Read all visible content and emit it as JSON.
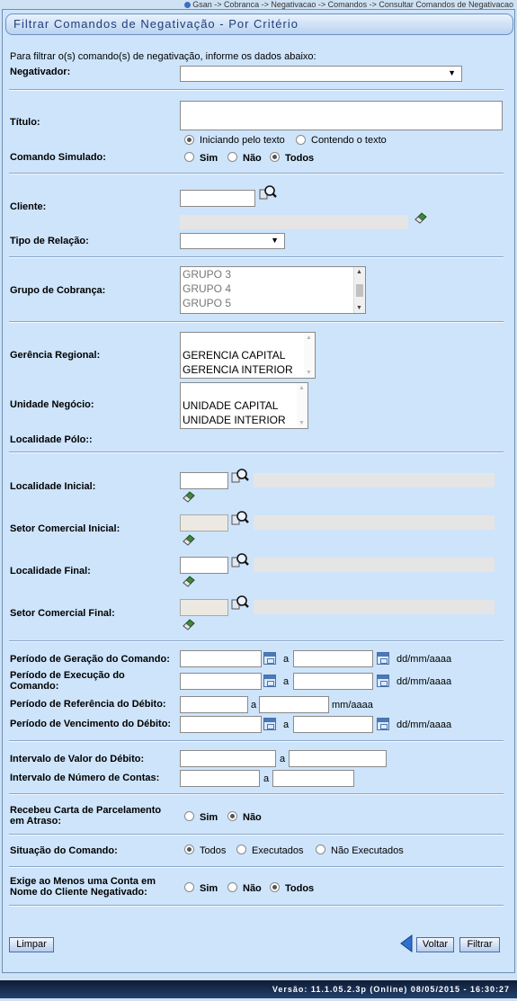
{
  "breadcrumb": "Gsan -> Cobranca -> Negativacao -> Comandos -> Consultar Comandos de Negativacao",
  "title": "Filtrar Comandos de Negativação - Por Critério",
  "intro": "Para filtrar o(s) comando(s) de negativação, informe os dados abaixo:",
  "labels": {
    "negativador": "Negativador:",
    "titulo": "Título:",
    "comando_simulado": "Comando Simulado:",
    "cliente": "Cliente:",
    "tipo_relacao": "Tipo de Relação:",
    "grupo_cobranca": "Grupo de Cobrança:",
    "gerencia_regional": "Gerência Regional:",
    "unidade_negocio": "Unidade Negócio:",
    "localidade_polo": "Localidade Pólo::",
    "localidade_inicial": "Localidade Inicial:",
    "setor_inicial": "Setor Comercial Inicial:",
    "localidade_final": "Localidade Final:",
    "setor_final": "Setor Comercial Final:",
    "periodo_geracao": "Período de Geração do Comando:",
    "periodo_execucao": "Período de Execução do Comando:",
    "periodo_referencia": "Período de Referência do Débito:",
    "periodo_vencimento": "Período de Vencimento do Débito:",
    "intervalo_valor": "Intervalo de Valor do Débito:",
    "intervalo_contas": "Intervalo de Número de Contas:",
    "recebeu_carta": "Recebeu Carta de Parcelamento em Atraso:",
    "situacao": "Situação do Comando:",
    "exige_conta": "Exige ao Menos uma Conta em Nome do Cliente Negativado:"
  },
  "titulo_options": {
    "iniciando": "Iniciando pelo texto",
    "contendo": "Contendo o texto"
  },
  "opt": {
    "sim": "Sim",
    "nao": "Não",
    "todos": "Todos",
    "executados": "Executados",
    "nao_executados": "Não Executados"
  },
  "sep_a": "a",
  "fmt_date": "dd/mm/aaaa",
  "fmt_month": "mm/aaaa",
  "grupos": [
    "GRUPO 3",
    "GRUPO 4",
    "GRUPO 5"
  ],
  "gerencias": [
    "GERENCIA CAPITAL",
    "GERENCIA INTERIOR"
  ],
  "unidades": [
    "UNIDADE CAPITAL",
    "UNIDADE INTERIOR"
  ],
  "buttons": {
    "limpar": "Limpar",
    "voltar": "Voltar",
    "filtrar": "Filtrar"
  },
  "version": "Versão: 11.1.05.2.3p (Online) 08/05/2015 - 16:30:27",
  "icons": {
    "search": "magnifier-icon",
    "erase": "eraser-icon",
    "calendar": "calendar-icon",
    "back": "back-arrow-icon"
  }
}
